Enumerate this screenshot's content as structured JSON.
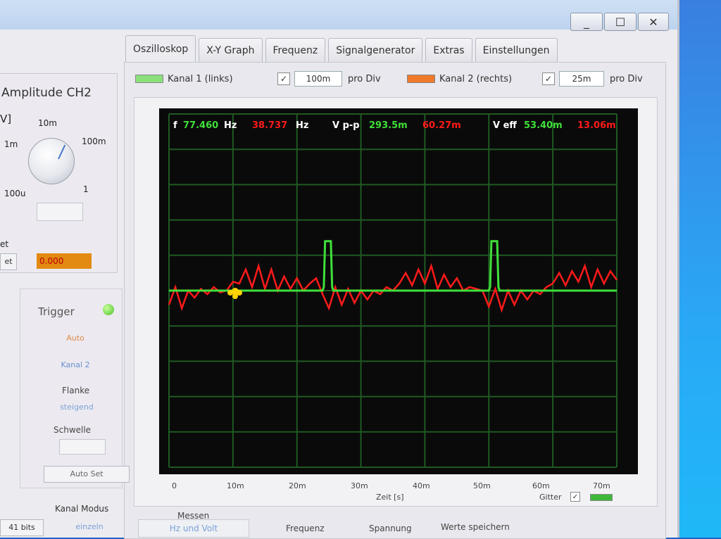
{
  "tabs": [
    "Oszilloskop",
    "X-Y Graph",
    "Frequenz",
    "Signalgenerator",
    "Extras",
    "Einstellungen"
  ],
  "window_controls": {
    "minimize": "_",
    "maximize": "☐",
    "close": "✕"
  },
  "channels": {
    "ch1": {
      "label": "Kanal 1 (links)",
      "scale": "100m",
      "color": "#8ae07a"
    },
    "ch2": {
      "label": "Kanal 2 (rechts)",
      "scale": "25m",
      "color": "#f07a2a"
    },
    "pro_div": "pro Div",
    "check": "✓"
  },
  "amplitude": {
    "title": "Amplitude CH2",
    "unit": "V]",
    "knob_labels": {
      "l10m": "10m",
      "l1m": "1m",
      "l100m": "100m",
      "l100u": "100u",
      "l1": "1"
    }
  },
  "offset": {
    "label": "et",
    "button": "et",
    "value": "0.000"
  },
  "trigger": {
    "title": "Trigger",
    "mode": "Auto",
    "source": "Kanal 2",
    "flanke_label": "Flanke",
    "flanke_value": "steigend",
    "schwelle_label": "Schwelle",
    "autoset": "Auto Set"
  },
  "kanal_modus": {
    "label": "Kanal Modus",
    "value": "einzeln",
    "bits": "41 bits"
  },
  "measurements": {
    "f_label": "f",
    "f_ch1": "77.460",
    "f_unit1": "Hz",
    "f_ch2": "38.737",
    "f_unit2": "Hz",
    "vpp_label": "V p-p",
    "vpp_ch1": "293.5m",
    "vpp_ch2": "60.27m",
    "veff_label": "V eff",
    "veff_ch1": "53.40m",
    "veff_ch2": "13.06m"
  },
  "chart_data": {
    "type": "line",
    "xlabel": "Zeit [s]",
    "x_ticks": [
      "0",
      "10m",
      "20m",
      "30m",
      "40m",
      "50m",
      "60m",
      "70m"
    ],
    "xlim": [
      0,
      0.07
    ],
    "ylim": [
      -5,
      5
    ],
    "grid": true,
    "series": [
      {
        "name": "Kanal 1 (links)",
        "color": "#3fe03a",
        "x": [
          0,
          0.024,
          0.0242,
          0.0244,
          0.0253,
          0.0255,
          0.0257,
          0.05,
          0.0502,
          0.0504,
          0.0513,
          0.0515,
          0.0517,
          0.07
        ],
        "y": [
          0,
          0,
          0.1,
          1.4,
          1.4,
          0.1,
          0,
          0,
          0.1,
          1.4,
          1.4,
          0.1,
          0,
          0
        ]
      },
      {
        "name": "Kanal 2 (rechts)",
        "color": "#ff1a1a",
        "x": [
          0,
          0.001,
          0.002,
          0.003,
          0.004,
          0.005,
          0.006,
          0.007,
          0.008,
          0.009,
          0.01,
          0.011,
          0.012,
          0.013,
          0.014,
          0.015,
          0.016,
          0.017,
          0.018,
          0.019,
          0.02,
          0.021,
          0.022,
          0.023,
          0.024,
          0.025,
          0.026,
          0.027,
          0.028,
          0.029,
          0.03,
          0.031,
          0.032,
          0.033,
          0.034,
          0.035,
          0.036,
          0.037,
          0.038,
          0.039,
          0.04,
          0.041,
          0.042,
          0.043,
          0.044,
          0.045,
          0.046,
          0.047,
          0.048,
          0.049,
          0.05,
          0.051,
          0.052,
          0.053,
          0.054,
          0.055,
          0.056,
          0.057,
          0.058,
          0.059,
          0.06,
          0.061,
          0.062,
          0.063,
          0.064,
          0.065,
          0.066,
          0.067,
          0.068,
          0.069,
          0.07
        ],
        "y": [
          -0.4,
          0.1,
          -0.5,
          0.0,
          -0.2,
          0.05,
          -0.1,
          0.1,
          -0.05,
          0.0,
          0.25,
          0.2,
          0.6,
          0.1,
          0.7,
          0.05,
          0.6,
          0.0,
          0.4,
          0.05,
          0.35,
          0.0,
          0.2,
          0.35,
          -0.1,
          -0.5,
          0.1,
          -0.4,
          0.05,
          -0.35,
          0.0,
          -0.25,
          0.0,
          -0.1,
          0.1,
          0.0,
          0.2,
          0.5,
          0.15,
          0.6,
          0.2,
          0.7,
          0.05,
          0.45,
          0.1,
          0.35,
          0.0,
          0.1,
          0.05,
          0.0,
          -0.45,
          0.05,
          -0.55,
          0.0,
          -0.4,
          0.0,
          -0.25,
          0.0,
          -0.1,
          0.1,
          0.2,
          0.5,
          0.15,
          0.55,
          0.25,
          0.7,
          0.1,
          0.6,
          0.2,
          0.55,
          0.3
        ]
      }
    ]
  },
  "grid_toggle": {
    "label": "Gitter",
    "check": "✓"
  },
  "bottom": {
    "messen_title": "Messen",
    "hz_und_volt": "Hz und Volt",
    "frequenz": "Frequenz",
    "spannung": "Spannung",
    "werte_speichern": "Werte speichern"
  }
}
